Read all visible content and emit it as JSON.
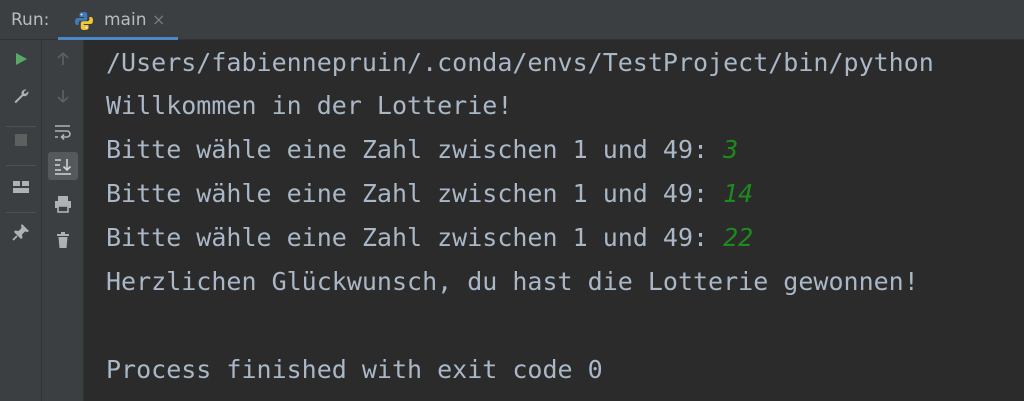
{
  "run_panel": {
    "label": "Run:",
    "tab": {
      "label": "main",
      "close": "×",
      "icon": "python-icon"
    }
  },
  "toolbar_left": [
    "run-icon",
    "wrench-icon",
    "stop-icon",
    "layout-icon",
    "pin-icon"
  ],
  "toolbar_right": [
    "up-arrow-icon",
    "down-arrow-icon",
    "soft-wrap-icon",
    "scroll-to-end-icon",
    "print-icon",
    "trash-icon"
  ],
  "console": {
    "path_line": "/Users/fabiennepruin/.conda/envs/TestProject/bin/python",
    "welcome": "Willkommen in der Lotterie!",
    "prompts": [
      {
        "text": "Bitte wähle eine Zahl zwischen 1 und 49: ",
        "input": "3"
      },
      {
        "text": "Bitte wähle eine Zahl zwischen 1 und 49: ",
        "input": "14"
      },
      {
        "text": "Bitte wähle eine Zahl zwischen 1 und 49: ",
        "input": "22"
      }
    ],
    "result": "Herzlichen Glückwunsch, du hast die Lotterie gewonnen!",
    "exit_message": "Process finished with exit code 0"
  },
  "colors": {
    "background": "#2b2b2b",
    "panel": "#3c3f41",
    "text": "#a9b7c6",
    "user_input": "#1e8a1e",
    "tab_accent": "#4a88c7",
    "run_green": "#59a869"
  }
}
